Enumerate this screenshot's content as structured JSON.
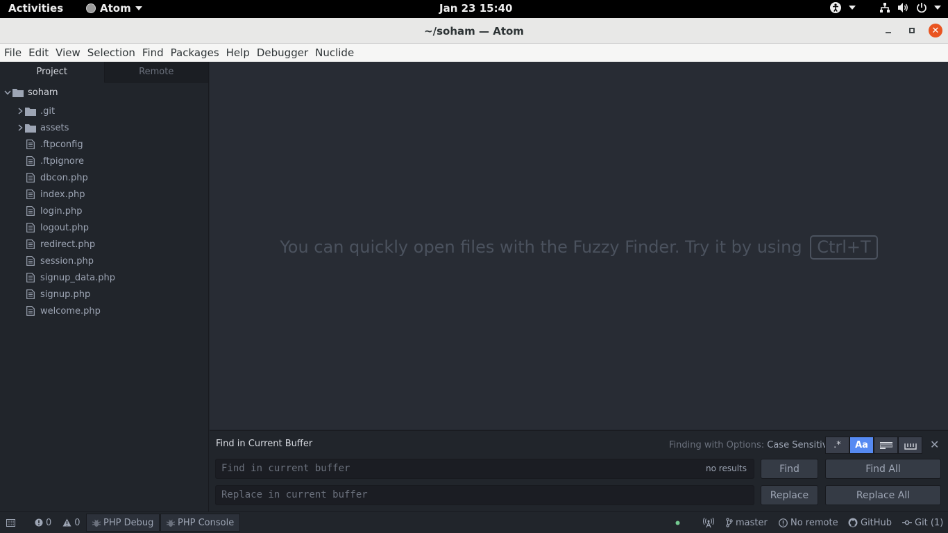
{
  "topbar": {
    "activities": "Activities",
    "app_name": "Atom",
    "clock": "Jan 23  15:40"
  },
  "window": {
    "title": "~/soham — Atom"
  },
  "menu": [
    "File",
    "Edit",
    "View",
    "Selection",
    "Find",
    "Packages",
    "Help",
    "Debugger",
    "Nuclide"
  ],
  "sidebar": {
    "tabs": [
      "Project",
      "Remote"
    ],
    "root": "soham",
    "folders": [
      ".git",
      "assets"
    ],
    "files": [
      ".ftpconfig",
      ".ftpignore",
      "dbcon.php",
      "index.php",
      "login.php",
      "logout.php",
      "redirect.php",
      "session.php",
      "signup_data.php",
      "signup.php",
      "welcome.php"
    ]
  },
  "editor": {
    "hint": "You can quickly open files with the Fuzzy Finder. Try it by using",
    "shortcut": "Ctrl+T"
  },
  "find": {
    "heading": "Find in Current Buffer",
    "options_label": "Finding with Options:",
    "options_value": "Case Sensitive",
    "find_placeholder": "Find in current buffer",
    "results": "no results",
    "replace_placeholder": "Replace in current buffer",
    "find_btn": "Find",
    "find_all_btn": "Find All",
    "replace_btn": "Replace",
    "replace_all_btn": "Replace All",
    "regex_glyph": ".*",
    "case_glyph": "Aa"
  },
  "status": {
    "errors": "0",
    "warnings": "0",
    "php_debug": "PHP Debug",
    "php_console": "PHP Console",
    "branch": "master",
    "remote": "No remote",
    "github": "GitHub",
    "git": "Git (1)"
  },
  "colors": {
    "accent": "#568af2",
    "close": "#e95420",
    "status_dot": "#73c990"
  }
}
